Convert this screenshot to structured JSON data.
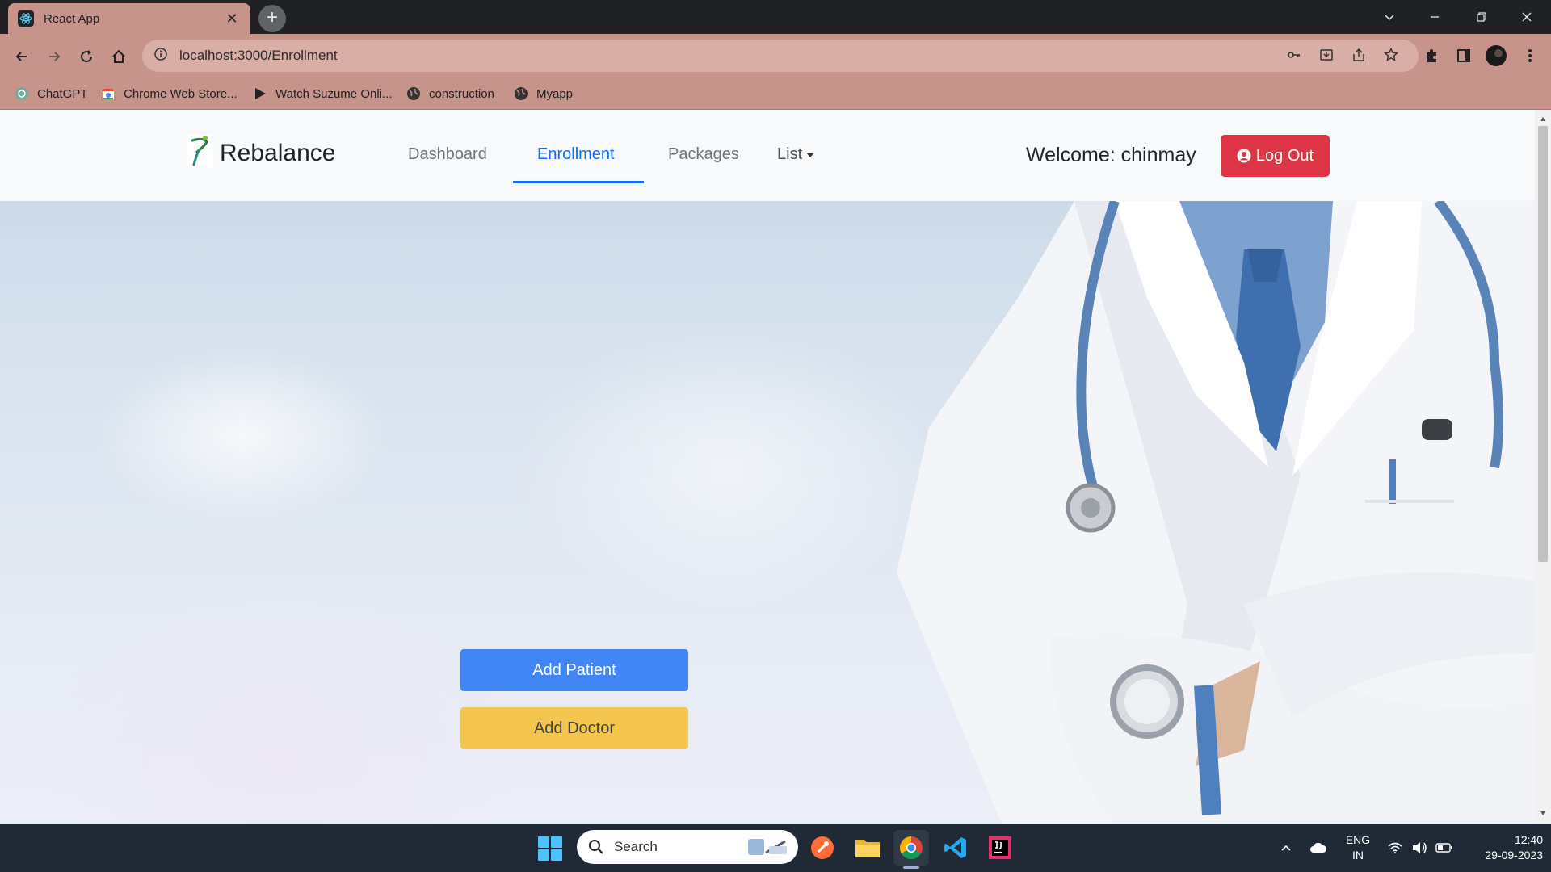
{
  "browser": {
    "tab_title": "React App",
    "tab_close": "✕",
    "new_tab": "+",
    "url": "localhost:3000/Enrollment",
    "bookmarks": [
      {
        "label": "ChatGPT",
        "icon": "chatgpt-icon"
      },
      {
        "label": "Chrome Web Store...",
        "icon": "chrome-web-store-icon"
      },
      {
        "label": "Watch Suzume Onli...",
        "icon": "play-icon"
      },
      {
        "label": "construction",
        "icon": "globe-icon"
      },
      {
        "label": "Myapp",
        "icon": "globe-icon"
      }
    ]
  },
  "navbar": {
    "brand": "Rebalance",
    "links": [
      {
        "label": "Dashboard",
        "active": false
      },
      {
        "label": "Enrollment",
        "active": true
      },
      {
        "label": "Packages",
        "active": false
      },
      {
        "label": "List",
        "active": false
      }
    ],
    "welcome": "Welcome: chinmay",
    "logout_label": "Log Out"
  },
  "main": {
    "add_patient_label": "Add Patient",
    "add_doctor_label": "Add Doctor"
  },
  "taskbar": {
    "search_placeholder": "Search",
    "lang_line1": "ENG",
    "lang_line2": "IN",
    "time": "12:40",
    "date": "29-09-2023"
  },
  "colors": {
    "primary": "#0d6efd",
    "danger": "#dc3545",
    "add_patient": "#4285f4",
    "add_doctor": "#f4c64f",
    "chrome_theme": "#c7948c"
  }
}
